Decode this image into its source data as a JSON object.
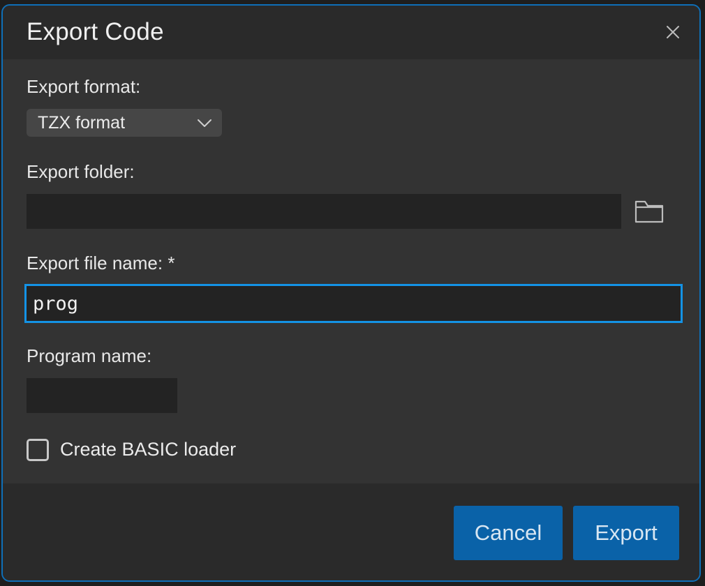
{
  "dialog": {
    "title": "Export Code",
    "close_icon": "close-icon"
  },
  "export_format": {
    "label": "Export format:",
    "selected": "TZX format",
    "icon": "chevron-down-icon"
  },
  "export_folder": {
    "label": "Export folder:",
    "value": "",
    "icon": "folder-icon"
  },
  "export_file_name": {
    "label": "Export file name: *",
    "value": "prog"
  },
  "program_name": {
    "label": "Program name:",
    "value": ""
  },
  "basic_loader": {
    "label": "Create BASIC loader",
    "checked": false
  },
  "buttons": {
    "cancel": "Cancel",
    "export": "Export"
  },
  "colors": {
    "accent": "#0a62a8",
    "focus": "#1493e6",
    "dialog_border": "#0e6fb8"
  }
}
